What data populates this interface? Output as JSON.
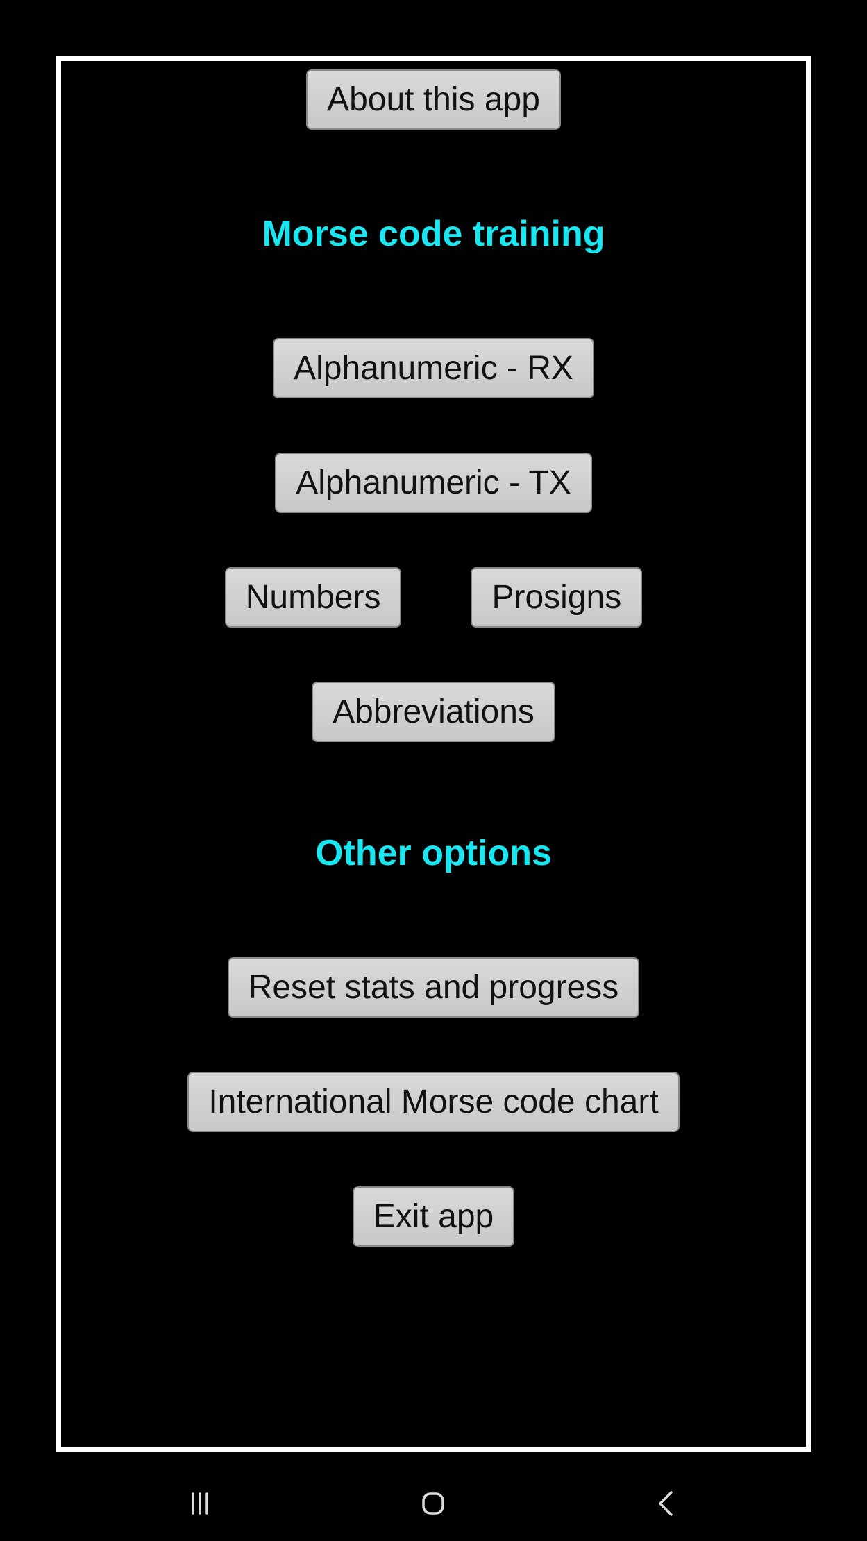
{
  "buttons": {
    "about": "About this app",
    "alnum_rx": "Alphanumeric - RX",
    "alnum_tx": "Alphanumeric - TX",
    "numbers": "Numbers",
    "prosigns": "Prosigns",
    "abbreviations": "Abbreviations",
    "reset": "Reset stats and progress",
    "chart": "International Morse code chart",
    "exit": "Exit app"
  },
  "headings": {
    "training": "Morse code training",
    "other": "Other options"
  }
}
